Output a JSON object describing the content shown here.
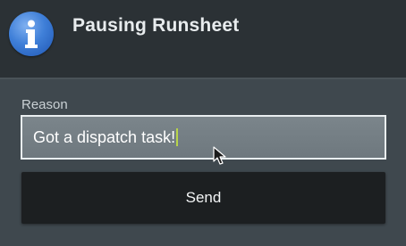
{
  "dialog": {
    "title": "Pausing Runsheet",
    "icon": "info-icon",
    "reason": {
      "label": "Reason",
      "value": "Got a dispatch task!"
    },
    "send_label": "Send"
  },
  "colors": {
    "title_bar": "#2b3135",
    "content_bg": "#3f484e",
    "input_bg": "#737d83",
    "button_bg": "#1c1f21",
    "icon_blue": "#3f7fd8",
    "caret": "#b8d44a"
  }
}
